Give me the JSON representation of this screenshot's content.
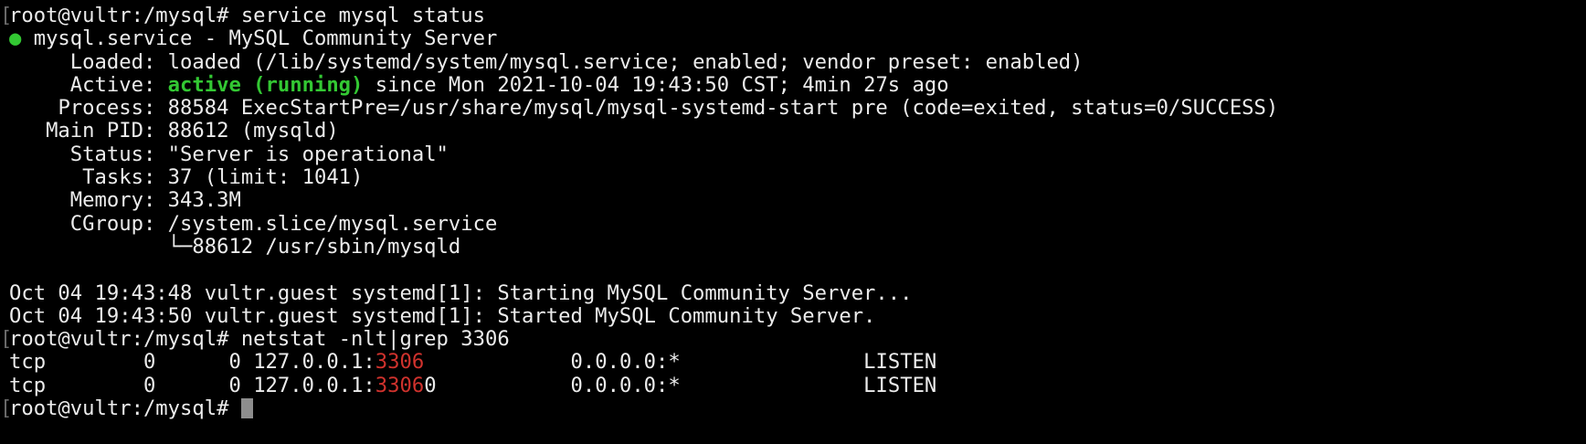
{
  "prompt": "root@vultr:/mysql#",
  "commands": {
    "first": "service mysql status",
    "second": "netstat -nlt|grep 3306"
  },
  "status": {
    "dot": "●",
    "unit_line": "mysql.service - MySQL Community Server",
    "loaded_label": "Loaded:",
    "loaded_value": "loaded (/lib/systemd/system/mysql.service; enabled; vendor preset: enabled)",
    "active_label": "Active:",
    "active_state": "active (running)",
    "active_since": "since Mon 2021-10-04 19:43:50 CST; 4min 27s ago",
    "process_label": "Process:",
    "process_value": "88584 ExecStartPre=/usr/share/mysql/mysql-systemd-start pre (code=exited, status=0/SUCCESS)",
    "mainpid_label": "Main PID:",
    "mainpid_value": "88612 (mysqld)",
    "status_label": "Status:",
    "status_value": "\"Server is operational\"",
    "tasks_label": "Tasks:",
    "tasks_value": "37 (limit: 1041)",
    "memory_label": "Memory:",
    "memory_value": "343.3M",
    "cgroup_label": "CGroup:",
    "cgroup_value": "/system.slice/mysql.service",
    "cgroup_child": "└─88612 /usr/sbin/mysqld"
  },
  "journal": [
    "Oct 04 19:43:48 vultr.guest systemd[1]: Starting MySQL Community Server...",
    "Oct 04 19:43:50 vultr.guest systemd[1]: Started MySQL Community Server."
  ],
  "netstat": [
    {
      "proto": "tcp",
      "recvq": "0",
      "sendq": "0",
      "addr_prefix": "127.0.0.1:",
      "port_match": "3306",
      "port_rest": "",
      "foreign": "0.0.0.0:*",
      "state": "LISTEN"
    },
    {
      "proto": "tcp",
      "recvq": "0",
      "sendq": "0",
      "addr_prefix": "127.0.0.1:",
      "port_match": "3306",
      "port_rest": "0",
      "foreign": "0.0.0.0:*",
      "state": "LISTEN"
    }
  ],
  "partial_prompt": "root@vultr:/mysql#",
  "colors": {
    "background": "#000000",
    "foreground": "#ececec",
    "active_green": "#33c833",
    "grep_red": "#d0322d"
  }
}
